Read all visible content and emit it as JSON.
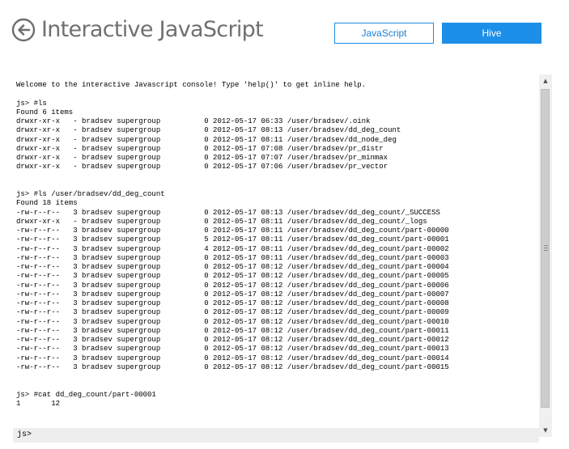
{
  "header": {
    "title": "Interactive JavaScript",
    "back_icon": "back-arrow-icon",
    "tabs": [
      {
        "label": "JavaScript",
        "active": true
      },
      {
        "label": "Hive",
        "active": false
      }
    ],
    "accent_color": "#1e8fe8"
  },
  "console": {
    "lines": [
      "Welcome to the interactive Javascript console! Type 'help()' to get inline help.",
      "",
      "js> #ls",
      "Found 6 items",
      "drwxr-xr-x   - bradsev supergroup          0 2012-05-17 06:33 /user/bradsev/.oink",
      "drwxr-xr-x   - bradsev supergroup          0 2012-05-17 08:13 /user/bradsev/dd_deg_count",
      "drwxr-xr-x   - bradsev supergroup          0 2012-05-17 08:11 /user/bradsev/dd_node_deg",
      "drwxr-xr-x   - bradsev supergroup          0 2012-05-17 07:08 /user/bradsev/pr_distr",
      "drwxr-xr-x   - bradsev supergroup          0 2012-05-17 07:07 /user/bradsev/pr_minmax",
      "drwxr-xr-x   - bradsev supergroup          0 2012-05-17 07:06 /user/bradsev/pr_vector",
      "",
      "",
      "js> #ls /user/bradsev/dd_deg_count",
      "Found 18 items",
      "-rw-r--r--   3 bradsev supergroup          0 2012-05-17 08:13 /user/bradsev/dd_deg_count/_SUCCESS",
      "drwxr-xr-x   - bradsev supergroup          0 2012-05-17 08:11 /user/bradsev/dd_deg_count/_logs",
      "-rw-r--r--   3 bradsev supergroup          0 2012-05-17 08:11 /user/bradsev/dd_deg_count/part-00000",
      "-rw-r--r--   3 bradsev supergroup          5 2012-05-17 08:11 /user/bradsev/dd_deg_count/part-00001",
      "-rw-r--r--   3 bradsev supergroup          4 2012-05-17 08:11 /user/bradsev/dd_deg_count/part-00002",
      "-rw-r--r--   3 bradsev supergroup          0 2012-05-17 08:11 /user/bradsev/dd_deg_count/part-00003",
      "-rw-r--r--   3 bradsev supergroup          0 2012-05-17 08:12 /user/bradsev/dd_deg_count/part-00004",
      "-rw-r--r--   3 bradsev supergroup          0 2012-05-17 08:12 /user/bradsev/dd_deg_count/part-00005",
      "-rw-r--r--   3 bradsev supergroup          0 2012-05-17 08:12 /user/bradsev/dd_deg_count/part-00006",
      "-rw-r--r--   3 bradsev supergroup          0 2012-05-17 08:12 /user/bradsev/dd_deg_count/part-00007",
      "-rw-r--r--   3 bradsev supergroup          0 2012-05-17 08:12 /user/bradsev/dd_deg_count/part-00008",
      "-rw-r--r--   3 bradsev supergroup          0 2012-05-17 08:12 /user/bradsev/dd_deg_count/part-00009",
      "-rw-r--r--   3 bradsev supergroup          0 2012-05-17 08:12 /user/bradsev/dd_deg_count/part-00010",
      "-rw-r--r--   3 bradsev supergroup          0 2012-05-17 08:12 /user/bradsev/dd_deg_count/part-00011",
      "-rw-r--r--   3 bradsev supergroup          0 2012-05-17 08:12 /user/bradsev/dd_deg_count/part-00012",
      "-rw-r--r--   3 bradsev supergroup          0 2012-05-17 08:12 /user/bradsev/dd_deg_count/part-00013",
      "-rw-r--r--   3 bradsev supergroup          0 2012-05-17 08:12 /user/bradsev/dd_deg_count/part-00014",
      "-rw-r--r--   3 bradsev supergroup          0 2012-05-17 08:12 /user/bradsev/dd_deg_count/part-00015",
      "",
      "",
      "js> #cat dd_deg_count/part-00001",
      "1       12"
    ]
  },
  "input": {
    "prompt": "js>",
    "value": ""
  },
  "scrollbar": {
    "up_icon": "scroll-up-arrow-icon",
    "down_icon": "scroll-down-arrow-icon"
  }
}
